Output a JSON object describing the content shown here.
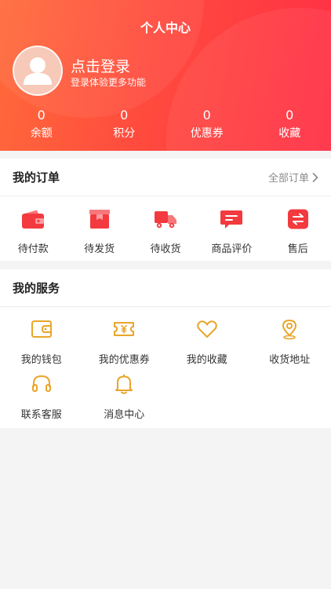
{
  "header": {
    "title": "个人中心",
    "login_title": "点击登录",
    "login_subtitle": "登录体验更多功能"
  },
  "stats": [
    {
      "value": "0",
      "label": "余额"
    },
    {
      "value": "0",
      "label": "积分"
    },
    {
      "value": "0",
      "label": "优惠券"
    },
    {
      "value": "0",
      "label": "收藏"
    }
  ],
  "orders": {
    "title": "我的订单",
    "all_link": "全部订单",
    "items": [
      {
        "label": "待付款",
        "icon": "wallet-icon"
      },
      {
        "label": "待发货",
        "icon": "package-icon"
      },
      {
        "label": "待收货",
        "icon": "truck-icon"
      },
      {
        "label": "商品评价",
        "icon": "comment-icon"
      },
      {
        "label": "售后",
        "icon": "exchange-icon"
      }
    ]
  },
  "services": {
    "title": "我的服务",
    "items": [
      {
        "label": "我的钱包",
        "icon": "wallet-icon"
      },
      {
        "label": "我的优惠券",
        "icon": "coupon-icon"
      },
      {
        "label": "我的收藏",
        "icon": "heart-icon"
      },
      {
        "label": "收货地址",
        "icon": "location-icon"
      },
      {
        "label": "联系客服",
        "icon": "headset-icon"
      },
      {
        "label": "消息中心",
        "icon": "bell-icon"
      }
    ]
  },
  "colors": {
    "header_start": "#ff6a3a",
    "header_end": "#ff2f45",
    "order_icon_red": "#f23a3f",
    "service_icon_gold": "#e9a52a"
  }
}
